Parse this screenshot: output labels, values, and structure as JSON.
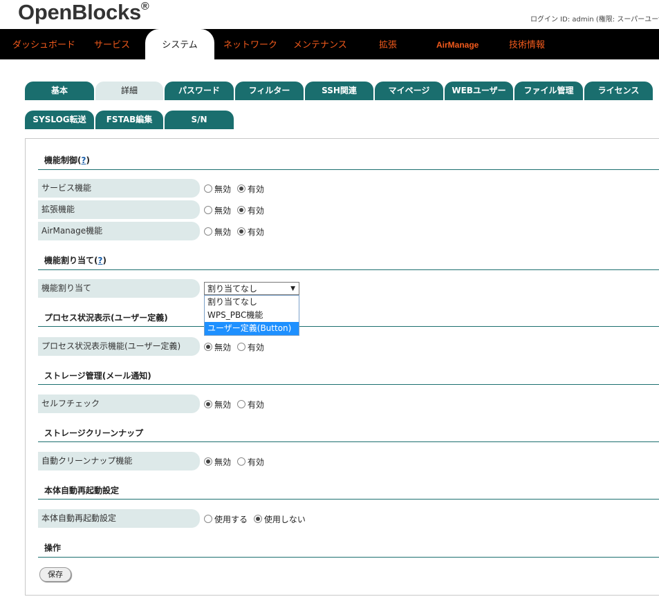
{
  "header": {
    "logo": "OpenBlocks",
    "logo_mark": "®",
    "login_info": "ログイン ID: admin (権限: スーパーユーザ"
  },
  "topnav": [
    {
      "label": "ダッシュボード"
    },
    {
      "label": "サービス"
    },
    {
      "label": "システム"
    },
    {
      "label": "ネットワーク"
    },
    {
      "label": "メンテナンス"
    },
    {
      "label": "拡張"
    },
    {
      "label": "AirManage"
    },
    {
      "label": "技術情報"
    }
  ],
  "tabs_row1": [
    {
      "label": "基本"
    },
    {
      "label": "詳細"
    },
    {
      "label": "パスワード"
    },
    {
      "label": "フィルター"
    },
    {
      "label": "SSH関連"
    },
    {
      "label": "マイページ"
    },
    {
      "label": "WEBユーザー"
    },
    {
      "label": "ファイル管理"
    },
    {
      "label": "ライセンス"
    }
  ],
  "tabs_row2": [
    {
      "label": "SYSLOG転送"
    },
    {
      "label": "FSTAB編集"
    },
    {
      "label": "S/N"
    }
  ],
  "sections": {
    "feature_control": {
      "title": "機能制御(",
      "help": "?",
      "close": ")"
    },
    "feature_assign": {
      "title": "機能割り当て(",
      "help": "?",
      "close": ")"
    },
    "process_status": {
      "title": "プロセス状況表示(ユーザー定義)"
    },
    "storage_mgmt": {
      "title": "ストレージ管理(メール通知)"
    },
    "storage_cleanup": {
      "title": "ストレージクリーンナップ"
    },
    "auto_reboot": {
      "title": "本体自動再起動設定"
    },
    "operation": {
      "title": "操作"
    }
  },
  "fields": {
    "service": {
      "label": "サービス機能",
      "opt1": "無効",
      "opt2": "有効",
      "selected": 2
    },
    "extension": {
      "label": "拡張機能",
      "opt1": "無効",
      "opt2": "有効",
      "selected": 2
    },
    "airmanage": {
      "label": "AirManage機能",
      "opt1": "無効",
      "opt2": "有効",
      "selected": 2
    },
    "assign": {
      "label": "機能割り当て"
    },
    "process_status": {
      "label": "プロセス状況表示機能(ユーザー定義)",
      "opt1": "無効",
      "opt2": "有効",
      "selected": 1
    },
    "self_check": {
      "label": "セルフチェック",
      "opt1": "無効",
      "opt2": "有効",
      "selected": 1
    },
    "auto_cleanup": {
      "label": "自動クリーンナップ機能",
      "opt1": "無効",
      "opt2": "有効",
      "selected": 1
    },
    "auto_reboot": {
      "label": "本体自動再起動設定",
      "opt1": "使用する",
      "opt2": "使用しない",
      "selected": 2
    }
  },
  "assign_select": {
    "value": "割り当てなし",
    "arrow": "▼",
    "options": [
      "割り当てなし",
      "WPS_PBC機能",
      "ユーザー定義(Button)"
    ],
    "highlighted": 2
  },
  "save_button": "保存"
}
